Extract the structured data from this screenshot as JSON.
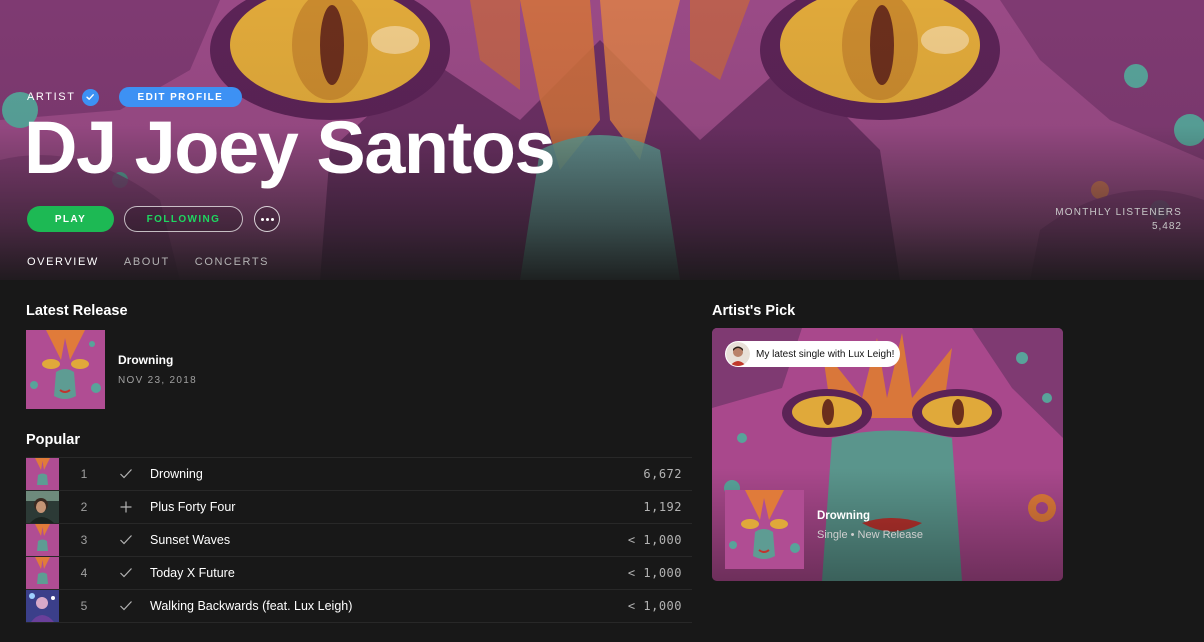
{
  "hero": {
    "artist_label": "ARTIST",
    "edit_profile_label": "EDIT PROFILE",
    "artist_name": "DJ Joey Santos",
    "play_label": "PLAY",
    "following_label": "FOLLOWING",
    "monthly_listeners_label": "MONTHLY LISTENERS",
    "monthly_listeners_value": "5,482"
  },
  "tabs": [
    {
      "label": "OVERVIEW",
      "active": true
    },
    {
      "label": "ABOUT",
      "active": false
    },
    {
      "label": "CONCERTS",
      "active": false
    }
  ],
  "latest_release": {
    "section_title": "Latest Release",
    "name": "Drowning",
    "date": "NOV 23, 2018"
  },
  "popular": {
    "section_title": "Popular",
    "tracks": [
      {
        "num": "1",
        "status": "check-icon",
        "title": "Drowning",
        "plays": "6,672"
      },
      {
        "num": "2",
        "status": "plus-icon",
        "title": "Plus Forty Four",
        "plays": "1,192"
      },
      {
        "num": "3",
        "status": "check-icon",
        "title": "Sunset Waves",
        "plays": "< 1,000"
      },
      {
        "num": "4",
        "status": "check-icon",
        "title": "Today X Future",
        "plays": "< 1,000"
      },
      {
        "num": "5",
        "status": "check-icon",
        "title": "Walking Backwards (feat. Lux Leigh)",
        "plays": "< 1,000"
      }
    ]
  },
  "artists_pick": {
    "section_title": "Artist's Pick",
    "quote": "My latest single with Lux Leigh!",
    "name": "Drowning",
    "subtitle": "Single • New Release"
  },
  "colors": {
    "accent_green": "#1db954",
    "verified_blue": "#3d91f4",
    "background": "#181818",
    "art_magenta": "#a94c8e"
  }
}
